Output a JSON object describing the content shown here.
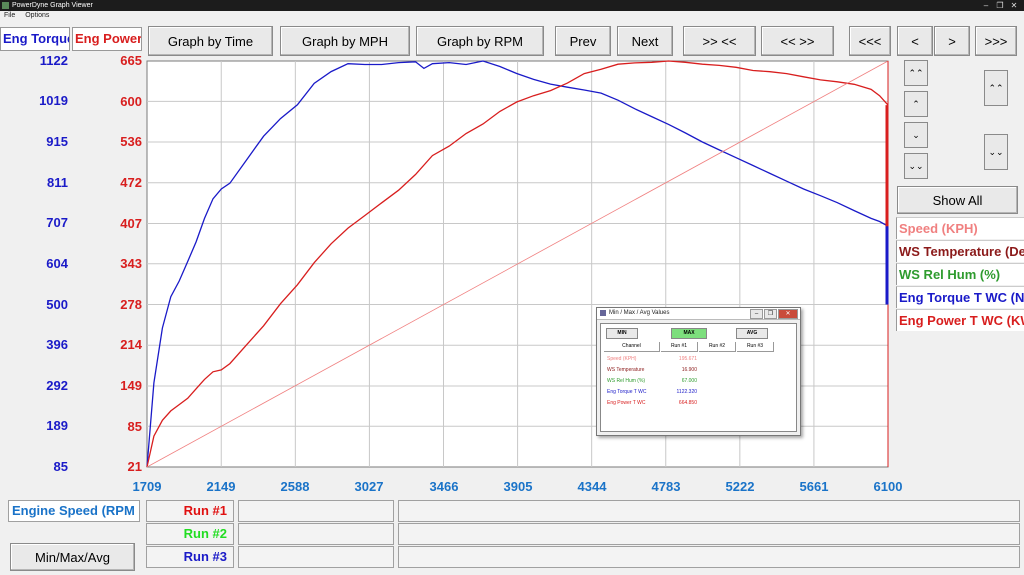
{
  "window": {
    "title": "PowerDyne Graph Viewer"
  },
  "menu": [
    "File",
    "Options"
  ],
  "toolbar": {
    "graph_time": "Graph by Time",
    "graph_mph": "Graph by MPH",
    "graph_rpm": "Graph by RPM",
    "prev": "Prev",
    "next": "Next",
    "zoom_in": ">> <<",
    "zoom_out": "<< >>",
    "pan_far_left": "<<<",
    "pan_left": "<",
    "pan_right": ">",
    "pan_far_right": ">>>"
  },
  "axes_labels": {
    "torque": "Eng Torque",
    "power": "Eng Power"
  },
  "side": {
    "show_all": "Show All",
    "scroll_top": "⌃⌃",
    "scroll_up": "⌃",
    "scroll_down": "⌄",
    "scroll_bottom": "⌄⌄"
  },
  "legend": [
    {
      "label": "Speed (KPH)",
      "color": "#f08080"
    },
    {
      "label": "WS Temperature (Deg C)",
      "color": "#8b1a1a"
    },
    {
      "label": "WS Rel Hum (%)",
      "color": "#2e9b2e"
    },
    {
      "label": "Eng Torque T WC (Nm)",
      "color": "#1a1ac8"
    },
    {
      "label": "Eng Power T WC (KW)",
      "color": "#d81e1e"
    }
  ],
  "bottom": {
    "x_channel": "Engine Speed (RPM",
    "runs": [
      {
        "label": "Run #1",
        "color": "#e01010"
      },
      {
        "label": "Run #2",
        "color": "#22dd22"
      },
      {
        "label": "Run #3",
        "color": "#1a1ac8"
      }
    ],
    "minmax_button": "Min/Max/Avg"
  },
  "popup": {
    "title": "Min / Max / Avg Values",
    "tabs": {
      "min": "MIN",
      "max": "MAX",
      "avg": "AVG"
    },
    "headers": [
      "Channel",
      "Run #1",
      "Run #2",
      "Run #3"
    ],
    "rows": [
      {
        "channel": "Speed (KPH)",
        "value": "195.671",
        "color": "#f08080"
      },
      {
        "channel": "WS Temperature",
        "value": "16.900",
        "color": "#8b1a1a"
      },
      {
        "channel": "WS Rel Hum (%)",
        "value": "67.000",
        "color": "#2e9b2e"
      },
      {
        "channel": "Eng Torque T WC",
        "value": "1122.320",
        "color": "#1a1ac8"
      },
      {
        "channel": "Eng Power T WC",
        "value": "664.850",
        "color": "#d81e1e"
      }
    ]
  },
  "chart_data": {
    "type": "line",
    "x_ticks": [
      1709,
      2149,
      2588,
      3027,
      3466,
      3905,
      4344,
      4783,
      5222,
      5661,
      6100
    ],
    "xlim": [
      1709,
      6100
    ],
    "y_torque_ticks": [
      85,
      189,
      292,
      396,
      500,
      604,
      707,
      811,
      915,
      1019,
      1122
    ],
    "y_torque_lim": [
      85,
      1122
    ],
    "y_power_ticks": [
      21,
      85,
      149,
      214,
      278,
      343,
      407,
      472,
      536,
      600,
      665
    ],
    "y_power_lim": [
      21,
      665
    ],
    "grid": true,
    "series": [
      {
        "name": "Eng Torque T WC",
        "axis": "torque",
        "color": "#1a1ac8",
        "x": [
          1709,
          1750,
          1800,
          1850,
          1900,
          1950,
          2000,
          2050,
          2100,
          2149,
          2200,
          2300,
          2400,
          2500,
          2600,
          2700,
          2800,
          2900,
          3000,
          3100,
          3200,
          3300,
          3350,
          3400,
          3500,
          3600,
          3700,
          3800,
          3900,
          4000,
          4100,
          4200,
          4300,
          4400,
          4500,
          4600,
          4700,
          4800,
          4900,
          5000,
          5100,
          5200,
          5300,
          5400,
          5500,
          5600,
          5700,
          5800,
          5900,
          6000,
          6050,
          6100
        ],
        "y": [
          85,
          300,
          440,
          520,
          560,
          610,
          660,
          720,
          770,
          795,
          810,
          870,
          930,
          975,
          1010,
          1065,
          1095,
          1115,
          1113,
          1113,
          1118,
          1120,
          1103,
          1115,
          1118,
          1113,
          1122,
          1108,
          1090,
          1075,
          1063,
          1055,
          1048,
          1040,
          1022,
          1000,
          980,
          960,
          938,
          915,
          895,
          875,
          855,
          835,
          815,
          795,
          778,
          760,
          740,
          720,
          712,
          700
        ]
      },
      {
        "name": "Eng Power T WC",
        "axis": "power",
        "color": "#d81e1e",
        "x": [
          1709,
          1750,
          1800,
          1850,
          1900,
          1950,
          2000,
          2050,
          2100,
          2149,
          2200,
          2300,
          2400,
          2500,
          2600,
          2700,
          2800,
          2900,
          3000,
          3100,
          3200,
          3300,
          3400,
          3500,
          3600,
          3700,
          3800,
          3900,
          4000,
          4100,
          4200,
          4300,
          4400,
          4500,
          4600,
          4700,
          4800,
          4900,
          5000,
          5100,
          5200,
          5300,
          5400,
          5500,
          5600,
          5700,
          5800,
          5900,
          6000,
          6050,
          6100
        ],
        "y": [
          21,
          70,
          95,
          110,
          120,
          130,
          145,
          160,
          172,
          175,
          185,
          215,
          245,
          280,
          310,
          345,
          375,
          400,
          420,
          440,
          460,
          485,
          515,
          530,
          550,
          565,
          585,
          600,
          610,
          618,
          630,
          645,
          652,
          660,
          662,
          663,
          665,
          663,
          660,
          658,
          655,
          650,
          648,
          645,
          640,
          635,
          632,
          628,
          620,
          610,
          595
        ]
      },
      {
        "name": "Speed (KPH)",
        "axis": "power",
        "color": "#f08080",
        "x": [
          1709,
          6100
        ],
        "y": [
          21,
          665
        ]
      }
    ]
  }
}
